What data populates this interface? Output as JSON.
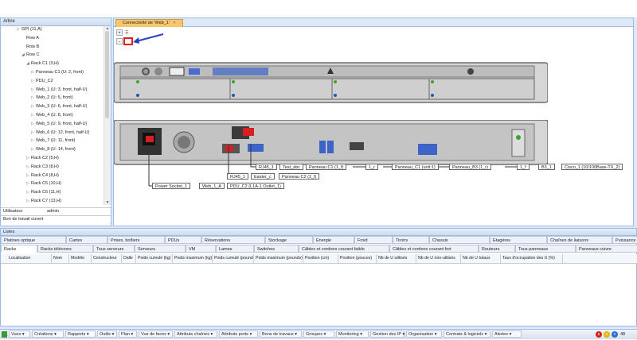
{
  "left_panel": {
    "title": "Arbre",
    "tree": [
      {
        "label": "GPI (11,A)",
        "indent": 3,
        "arrow": "▷"
      },
      {
        "label": "Row A",
        "indent": 4,
        "arrow": ""
      },
      {
        "label": "Row B",
        "indent": 4,
        "arrow": ""
      },
      {
        "label": "Row C",
        "indent": 4,
        "arrow": "◢"
      },
      {
        "label": "Rack C1 (3,H)",
        "indent": 5,
        "arrow": "◢"
      },
      {
        "label": "Panneau C1 (U: 2, front)",
        "indent": 6,
        "arrow": "▷"
      },
      {
        "label": "PDU_C2",
        "indent": 6,
        "arrow": "▷"
      },
      {
        "label": "Web_1 (U: 3, front, half-U)",
        "indent": 6,
        "arrow": "▷"
      },
      {
        "label": "Web_2 (U: 5, front)",
        "indent": 6,
        "arrow": "▷"
      },
      {
        "label": "Web_3 (U: 6, front, half-U)",
        "indent": 6,
        "arrow": "▷"
      },
      {
        "label": "Web_4 (U: 8, front)",
        "indent": 6,
        "arrow": "▷"
      },
      {
        "label": "Web_5 (U: 9, front, half-U)",
        "indent": 6,
        "arrow": "▷"
      },
      {
        "label": "Web_6 (U: 12, front, half-U)",
        "indent": 6,
        "arrow": "▷"
      },
      {
        "label": "Web_7 (U: 11, front)",
        "indent": 6,
        "arrow": "▷"
      },
      {
        "label": "Web_8 (U: 14, front)",
        "indent": 6,
        "arrow": "▷"
      },
      {
        "label": "Rack C2 (5,H)",
        "indent": 5,
        "arrow": "▷"
      },
      {
        "label": "Rack C3 (8,H)",
        "indent": 5,
        "arrow": "▷"
      },
      {
        "label": "Rack C4 (8,H)",
        "indent": 5,
        "arrow": "▷"
      },
      {
        "label": "Rack C5 (10,H)",
        "indent": 5,
        "arrow": "▷"
      },
      {
        "label": "Rack C6 (11,H)",
        "indent": 5,
        "arrow": "▷"
      },
      {
        "label": "Rack C7 (13,H)",
        "indent": 5,
        "arrow": "▷"
      }
    ],
    "props": [
      {
        "key": "Utilisateur",
        "value": "admin"
      },
      {
        "key": "Bon de travail ouvert",
        "value": ""
      }
    ]
  },
  "main_panel": {
    "tab_label": "Connectivité de 'Web_1'",
    "tool_plus": "+",
    "tool_minus": "-",
    "cable_labels": [
      {
        "id": "rj45_1",
        "text": "RJ45_1"
      },
      {
        "id": "test_abc",
        "text": "Test_abc"
      },
      {
        "id": "panneau_c1_1f",
        "text": "Panneau C1 (1_f)"
      },
      {
        "id": "r1",
        "text": "1_r"
      },
      {
        "id": "panneau_c1_unit",
        "text": "Panneau_C1 (unit:1)"
      },
      {
        "id": "panneau_b3",
        "text": "Panneau_B3 (1_r)"
      },
      {
        "id": "f1",
        "text": "1_f"
      },
      {
        "id": "b3_1",
        "text": "B3_1"
      },
      {
        "id": "cisco",
        "text": "Cisco_1 (10/100Base-TX_2)"
      },
      {
        "id": "rj45_1b",
        "text": "RJ45_1"
      },
      {
        "id": "easter",
        "text": "Easter_c"
      },
      {
        "id": "panneau_c2",
        "text": "Panneau C2 (2_f)"
      },
      {
        "id": "power_socket",
        "text": "Power Socket_1"
      },
      {
        "id": "web_1a",
        "text": "Web_1_A"
      },
      {
        "id": "pdu_c2",
        "text": "PDU_C2 (L1A-1 Outlet_1)"
      }
    ]
  },
  "bottom_panel": {
    "title": "Listes",
    "tabs_row1": [
      "Platines optique",
      "Cartes",
      "Prises, boîtiers",
      "PDUs",
      "Réservations",
      "Stockage",
      "Energie",
      "Froid",
      "Tiroirs",
      "Chassis",
      "Etagères",
      "Chaînes de liaisons",
      "Puissance & Temp"
    ],
    "tabs_row2": [
      "Racks",
      "Racks télécoms",
      "Tous serveurs",
      "Serveurs",
      "VM",
      "Lames",
      "Switches",
      "Câbles et cordons courant faible",
      "Câbles et cordons courant fort",
      "Routeurs",
      "Tous panneaux",
      "Panneaux cuivre"
    ],
    "columns": [
      "Localisation",
      "Nom",
      "Modèle",
      "Constructeur",
      "Dalle",
      "Poids cumulé (kg)",
      "Poids maximum (kg)",
      "Poids cumulé (pounds)",
      "Poids maximum (pounds)",
      "Position (cm)",
      "Position (pouces)",
      "Nb de U utilisés",
      "Nb de U non-utilisés",
      "Nb de U totaux",
      "Taux d'occupation des U (%)"
    ]
  },
  "menubar": {
    "items": [
      "Vues",
      "Créations",
      "Rapports",
      "Outils",
      "Plan",
      "Vue de faces",
      "Attributs chaînes",
      "Attributs ports",
      "Bons de travaux",
      "Groupes",
      "Monitoring",
      "Gestion des IP",
      "Organisation",
      "Contrats & logiciels",
      "Alertes"
    ],
    "badge_red": "8",
    "badge_yellow": "0",
    "badge_blue": "0",
    "badge_count": "48",
    "colors": {
      "red": "#d62020",
      "yellow": "#e8b400",
      "blue": "#2a6fcf"
    }
  }
}
